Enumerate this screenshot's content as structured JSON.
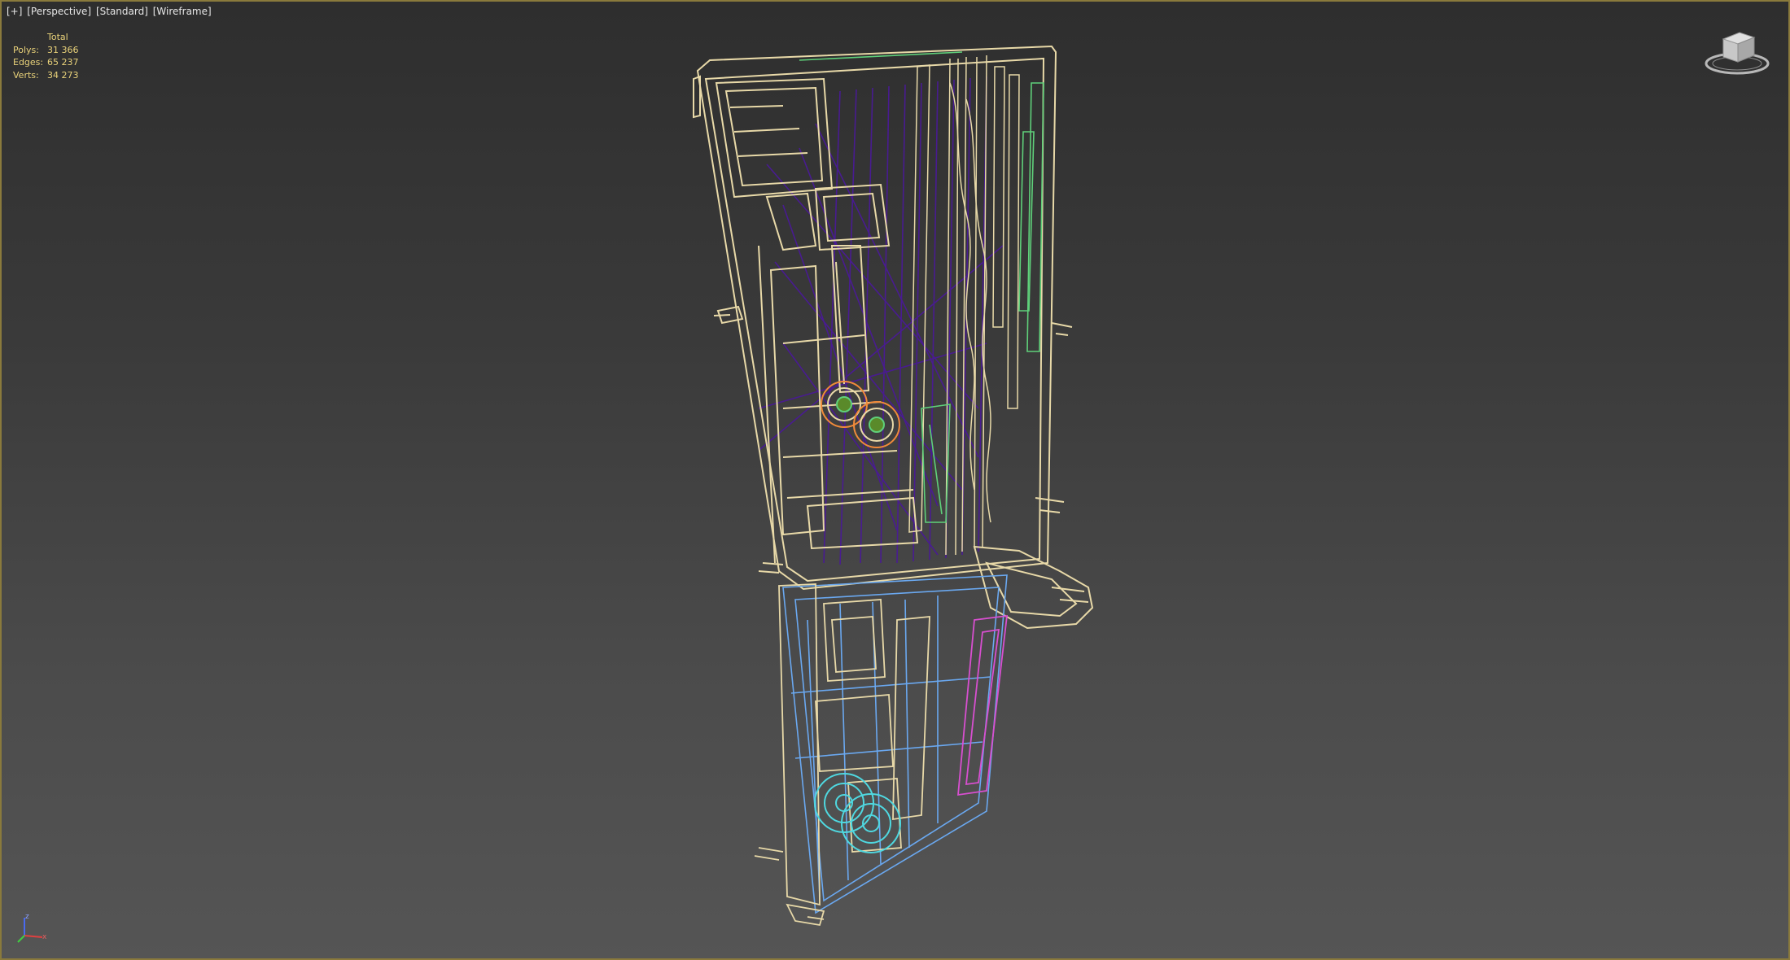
{
  "viewport": {
    "label_parts": [
      "[+]",
      "[Perspective]",
      "[Standard]",
      "[Wireframe]"
    ],
    "frame_color": "#8a7a3c"
  },
  "stats": {
    "header": "Total",
    "rows": [
      {
        "label": "Polys:",
        "value": "31 366"
      },
      {
        "label": "Edges:",
        "value": "65 237"
      },
      {
        "label": "Verts:",
        "value": "34 273"
      }
    ],
    "color": "#e9d27a"
  },
  "wire_colors": {
    "primary": "#e8d9a8",
    "purple": "#5a1fa8",
    "green": "#5fd07a",
    "blue": "#6aa8f0",
    "cyan": "#4fd8e0",
    "magenta": "#d84fd0",
    "orange": "#f08a3a"
  },
  "icons": {
    "viewcube": "viewcube-icon",
    "axis": "axis-tripod-icon"
  }
}
